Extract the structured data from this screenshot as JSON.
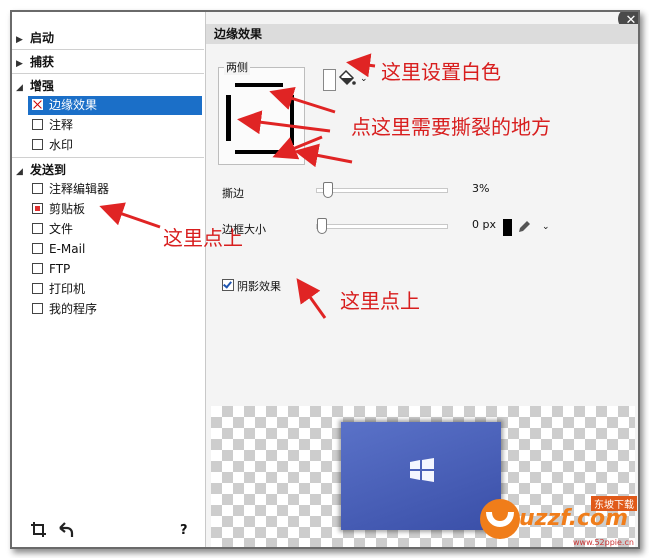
{
  "left_panel": {
    "sections": [
      {
        "label": "启动"
      },
      {
        "label": "捕获"
      },
      {
        "label": "增强"
      },
      {
        "label": "发送到"
      }
    ],
    "enhance_items": [
      {
        "label": "边缘效果",
        "selected": true
      },
      {
        "label": "注释"
      },
      {
        "label": "水印"
      }
    ],
    "send_items": [
      {
        "label": "注释编辑器"
      },
      {
        "label": "剪贴板",
        "checked": true
      },
      {
        "label": "文件"
      },
      {
        "label": "E-Mail"
      },
      {
        "label": "FTP"
      },
      {
        "label": "打印机"
      },
      {
        "label": "我的程序"
      }
    ],
    "help_label": "?"
  },
  "right_panel": {
    "title": "边缘效果",
    "group_label": "两侧",
    "tear_label": "撕边",
    "tear_value": "3%",
    "tear_level": 0.05,
    "border_label": "边框大小",
    "border_value": "0 px",
    "border_level": 0.0,
    "shadow_label": "阴影效果",
    "shadow_checked": true,
    "colors": {
      "swatch": "#ffffff",
      "border_color": "#000000",
      "selection": "#1b6fc8"
    }
  },
  "annotations": {
    "set_white": "这里设置白色",
    "tear_where": "点这里需要撕裂的地方",
    "click_here_1": "这里点上",
    "click_here_2": "这里点上"
  },
  "watermark": {
    "brand": "uzzf.com",
    "subtitle": "东坡下载",
    "url": "www.52ppie.cn"
  }
}
